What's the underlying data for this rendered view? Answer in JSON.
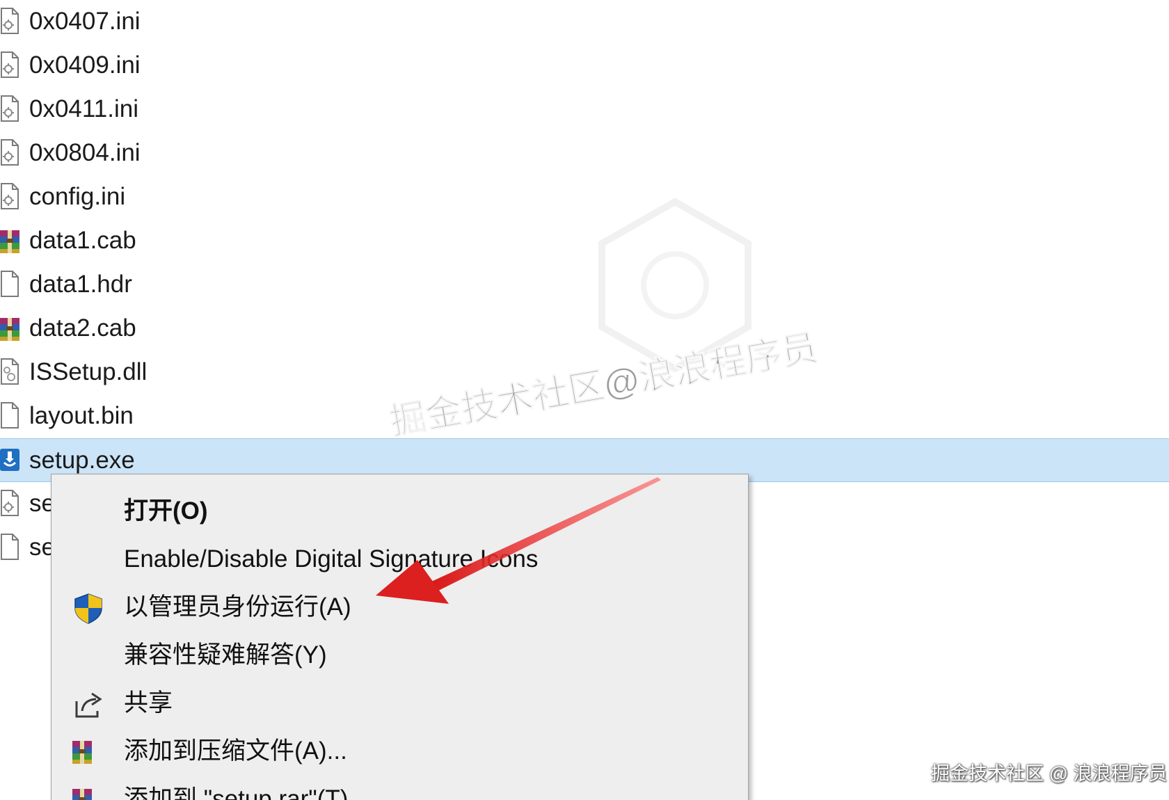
{
  "files": [
    {
      "name": "0x0407.ini",
      "icon": "ini-settings-file-icon"
    },
    {
      "name": "0x0409.ini",
      "icon": "ini-settings-file-icon"
    },
    {
      "name": "0x0411.ini",
      "icon": "ini-settings-file-icon"
    },
    {
      "name": "0x0804.ini",
      "icon": "ini-settings-file-icon"
    },
    {
      "name": "config.ini",
      "icon": "ini-settings-file-icon"
    },
    {
      "name": "data1.cab",
      "icon": "winrar-archive-icon"
    },
    {
      "name": "data1.hdr",
      "icon": "blank-file-icon"
    },
    {
      "name": "data2.cab",
      "icon": "winrar-archive-icon"
    },
    {
      "name": "ISSetup.dll",
      "icon": "dll-gear-file-icon"
    },
    {
      "name": "layout.bin",
      "icon": "blank-file-icon"
    },
    {
      "name": "setup.exe",
      "icon": "installer-exe-icon",
      "selected": true
    },
    {
      "name": "se",
      "icon": "ini-settings-file-icon"
    },
    {
      "name": "se",
      "icon": "blank-file-icon"
    }
  ],
  "context_menu": {
    "items": [
      {
        "label": "打开(O)",
        "icon": "",
        "bold": true
      },
      {
        "label": "Enable/Disable Digital Signature Icons",
        "icon": ""
      },
      {
        "label": "以管理员身份运行(A)",
        "icon": "uac-shield-icon"
      },
      {
        "label": "兼容性疑难解答(Y)",
        "icon": ""
      },
      {
        "label": "共享",
        "icon": "share-icon"
      },
      {
        "label": "添加到压缩文件(A)...",
        "icon": "winrar-archive-icon"
      },
      {
        "label": "添加到 \"setup.rar\"(T)",
        "icon": "winrar-archive-icon"
      }
    ]
  },
  "annotation": {
    "color": "#e02020",
    "points_to": "以管理员身份运行(A)"
  },
  "watermarks": {
    "center": "掘金技术社区@浪浪程序员",
    "corner": "掘金技术社区 @ 浪浪程序员"
  },
  "colors": {
    "selection_bg": "#cce4f7",
    "selection_border": "#99c9ef",
    "menu_bg": "#eeeeee",
    "arrow": "#e02020"
  }
}
